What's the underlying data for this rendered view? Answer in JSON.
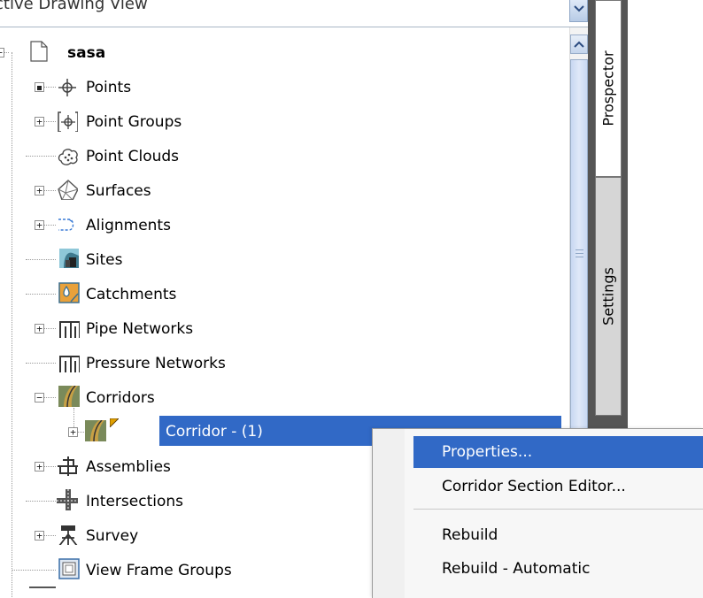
{
  "header": {
    "title": "ctive Drawing View"
  },
  "tree": {
    "root": {
      "label": "sasa"
    },
    "items": [
      {
        "label": "Points",
        "icon": "points-icon"
      },
      {
        "label": "Point Groups",
        "icon": "point-groups-icon"
      },
      {
        "label": "Point Clouds",
        "icon": "point-clouds-icon"
      },
      {
        "label": "Surfaces",
        "icon": "surfaces-icon"
      },
      {
        "label": "Alignments",
        "icon": "alignments-icon"
      },
      {
        "label": "Sites",
        "icon": "sites-icon"
      },
      {
        "label": "Catchments",
        "icon": "catchments-icon"
      },
      {
        "label": "Pipe Networks",
        "icon": "pipe-networks-icon"
      },
      {
        "label": "Pressure Networks",
        "icon": "pressure-networks-icon"
      },
      {
        "label": "Corridors",
        "icon": "corridors-icon"
      },
      {
        "label": "Corridor - (1)",
        "icon": "corridor-item-icon"
      },
      {
        "label": "Assemblies",
        "icon": "assemblies-icon"
      },
      {
        "label": "Intersections",
        "icon": "intersections-icon"
      },
      {
        "label": "Survey",
        "icon": "survey-icon"
      },
      {
        "label": "View Frame Groups",
        "icon": "view-frame-groups-icon"
      }
    ]
  },
  "tabs": [
    {
      "label": "Prospector"
    },
    {
      "label": "Settings"
    }
  ],
  "context_menu": {
    "items": [
      {
        "label": "Properties..."
      },
      {
        "label": "Corridor Section Editor..."
      },
      {
        "label": "Rebuild"
      },
      {
        "label": "Rebuild - Automatic"
      }
    ]
  },
  "colors": {
    "selection": "#3169c6",
    "sidebar": "#555555"
  }
}
